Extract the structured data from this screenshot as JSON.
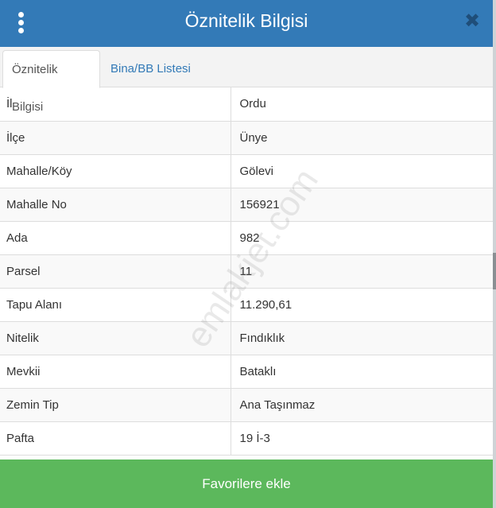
{
  "header": {
    "title": "Öznitelik Bilgisi",
    "menu_icon": "vertical-dots-icon",
    "close_icon": "close-icon",
    "close_glyph": "✖"
  },
  "tabs": [
    {
      "label": "Öznitelik Bilgisi",
      "active": true
    },
    {
      "label": "Bina/BB Listesi",
      "active": false
    }
  ],
  "attributes": [
    {
      "key": "İl",
      "value": "Ordu"
    },
    {
      "key": "İlçe",
      "value": "Ünye"
    },
    {
      "key": "Mahalle/Köy",
      "value": "Gölevi"
    },
    {
      "key": "Mahalle No",
      "value": "156921"
    },
    {
      "key": "Ada",
      "value": "982"
    },
    {
      "key": "Parsel",
      "value": "11"
    },
    {
      "key": "Tapu Alanı",
      "value": "11.290,61"
    },
    {
      "key": "Nitelik",
      "value": "Fındıklık"
    },
    {
      "key": "Mevkii",
      "value": "Bataklı"
    },
    {
      "key": "Zemin Tip",
      "value": "Ana Taşınmaz"
    },
    {
      "key": "Pafta",
      "value": "19 İ-3"
    }
  ],
  "watermark": "emlakjet.com",
  "footer": {
    "button_label": "Favorilere ekle"
  },
  "colors": {
    "header_bg": "#337ab7",
    "tab_link": "#337ab7",
    "button_bg": "#5cb85c",
    "close_icon": "#1f4e79"
  }
}
